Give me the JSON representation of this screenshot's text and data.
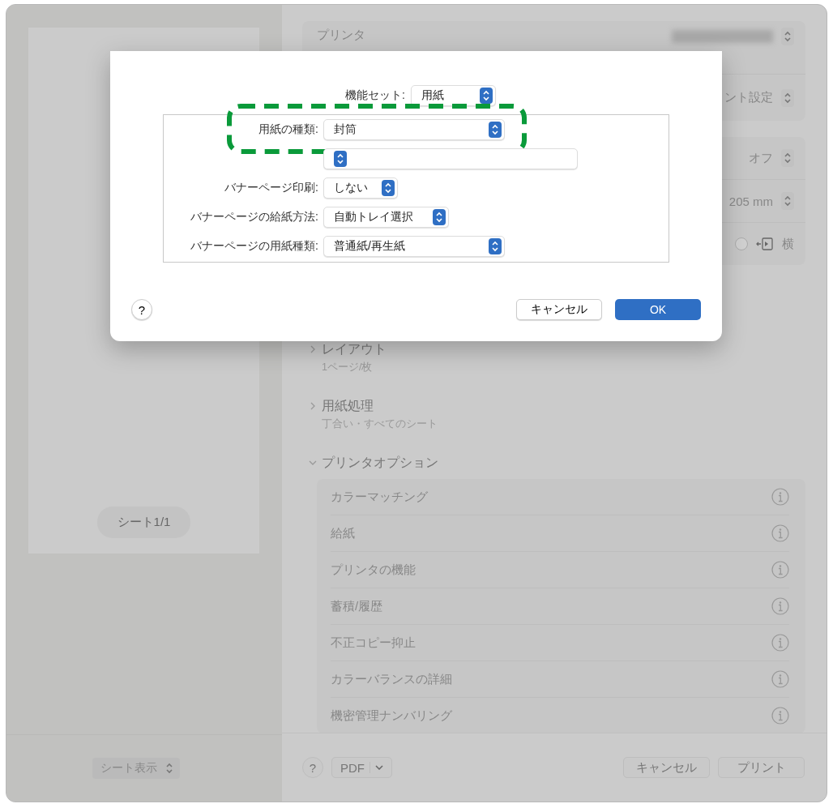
{
  "print_dialog": {
    "preview": {
      "sheet_counter": "シート1/1",
      "view_mode": "シート表示"
    },
    "printer_card": {
      "printer_label": "プリンタ",
      "preset_value": "ント設定"
    },
    "options": [
      {
        "kind": "popup",
        "value": "オフ"
      },
      {
        "kind": "popup",
        "value": "205 mm"
      },
      {
        "kind": "orientation",
        "selected": false,
        "value": "横"
      }
    ],
    "sections": [
      {
        "title": "レイアウト",
        "summary": "1ページ/枚",
        "expanded": false
      },
      {
        "title": "用紙処理",
        "summary": "丁合い・すべてのシート",
        "expanded": false
      },
      {
        "title": "プリンタオプション",
        "expanded": true,
        "items": [
          "カラーマッチング",
          "給紙",
          "プリンタの機能",
          "蓄積/履歴",
          "不正コピー抑止",
          "カラーバランスの詳細",
          "機密管理ナンバリング"
        ]
      }
    ],
    "footer": {
      "help": "?",
      "pdf": "PDF",
      "cancel": "キャンセル",
      "print": "プリント"
    }
  },
  "sheet": {
    "feature_set": {
      "label": "機能セット:",
      "value": "用紙"
    },
    "rows": [
      {
        "label": "用紙の種類:",
        "value": "封筒",
        "highlighted": true
      },
      {
        "highlighted": false
      },
      {
        "label": "バナーページ印刷:",
        "value": "しない",
        "highlighted": false
      },
      {
        "label": "バナーページの給紙方法:",
        "value": "自動トレイ選択",
        "highlighted": false
      },
      {
        "label": "バナーページの用紙種類:",
        "value": "普通紙/再生紙",
        "highlighted": false
      }
    ],
    "help": "?",
    "cancel": "キャンセル",
    "ok": "OK"
  }
}
